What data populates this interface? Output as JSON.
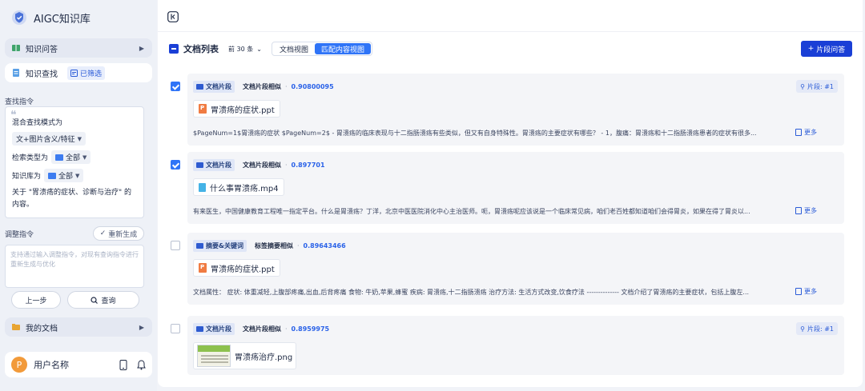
{
  "app": {
    "name": "AIGC知识库"
  },
  "sidebar": {
    "nav_qa": {
      "label": "知识问答"
    },
    "nav_search": {
      "label": "知识查找",
      "filter_badge": "已筛选"
    },
    "search_cmd": {
      "section_label": "查找指令",
      "mode_label": "混合查找模式为",
      "mode_value": "文+图片含义/特征",
      "type_label": "检索类型为",
      "type_value": "全部",
      "kb_label": "知识库为",
      "kb_value": "全部",
      "text": "关于 \"胃溃疡的症状、诊断与治疗\" 的内容。"
    },
    "adjust": {
      "section_label": "调整指令",
      "regen_label": "重新生成",
      "placeholder": "支持通过输入调整指令，对现有查询指令进行重新生成与优化"
    },
    "prev_label": "上一步",
    "query_label": "查询",
    "nav_docs": {
      "label": "我的文档"
    },
    "user": {
      "initial": "P",
      "name": "用户名称"
    }
  },
  "list": {
    "title": "文档列表",
    "top_n": "前 30 条",
    "views": [
      "文档视图",
      "匹配内容视图"
    ],
    "active_view": 1,
    "qa_button": "片段问答",
    "more_label": "更多",
    "results": [
      {
        "checked": true,
        "tag": "文档片段",
        "match": "文档片段相似",
        "score": "0.90800095",
        "frag": "片段: #1",
        "file": "胃溃疡的症状.ppt",
        "file_type": "ppt",
        "snippet": "$PageNum=1$胃溃疡的症状 $PageNum=2$ - 胃溃疡的临床表现与十二指肠溃疡有些类似，但又有自身特殊性。胃溃疡的主要症状有哪些？ - 1，腹痛：胃溃疡和十二指肠溃疡患者的症状有很多..."
      },
      {
        "checked": true,
        "tag": "文档片段",
        "match": "文档片段相似",
        "score": "0.897701",
        "frag": "",
        "file": "什么事胃溃疡.mp4",
        "file_type": "mp4",
        "snippet": "有来医生，中国健康教育工程唯一指定平台。什么是胃溃疡？丁洋，北京中医医院消化中心主治医师。呃，胃溃疡呢应该说是一个临床常见病，咱们老百姓都知道咱们会得胃炎，如果在得了胃炎以..."
      },
      {
        "checked": false,
        "tag": "摘要&关键词",
        "match": "标签摘要相似",
        "score": "0.89643466",
        "frag": "",
        "file": "胃溃疡的症状.ppt",
        "file_type": "ppt",
        "snippet": "文档属性： 症状: 体重减轻,上腹部疼痛,出血,后背疼痛 食物: 牛奶,苹果,蜂蜜 疾病: 胃溃疡,十二指肠溃疡 治疗方法: 生活方式改变,饮食疗法 -------------- 文档介绍了胃溃疡的主要症状，包括上腹左..."
      },
      {
        "checked": false,
        "tag": "文档片段",
        "match": "文档片段相似",
        "score": "0.8959975",
        "frag": "片段: #1",
        "file": "胃溃疡治疗.png",
        "file_type": "png",
        "snippet": ""
      }
    ]
  },
  "colors": {
    "primary": "#1a3fd6",
    "accent": "#2f74f7",
    "sidebar_bg": "#eef1f7"
  }
}
